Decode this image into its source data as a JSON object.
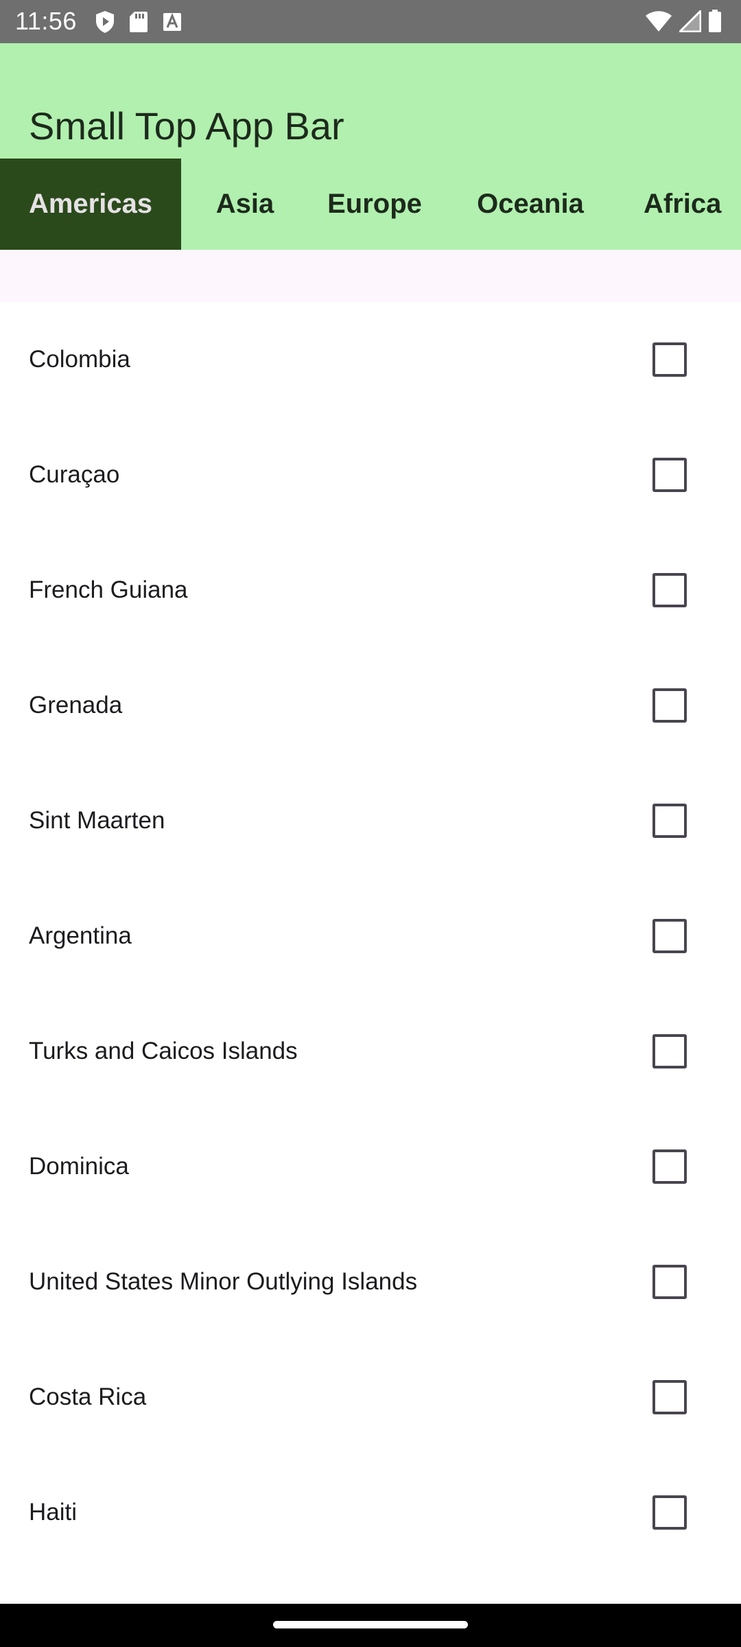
{
  "status_bar": {
    "time": "11:56",
    "left_icons": [
      "shield-play-icon",
      "sd-card-icon",
      "font-a-icon"
    ],
    "right_icons": [
      "wifi-icon",
      "cellular-signal-icon",
      "battery-icon"
    ],
    "background": "#6f6f6f"
  },
  "app_bar": {
    "title": "Small Top App Bar",
    "background": "#b1f0ae"
  },
  "tabs": [
    {
      "label": "Americas",
      "selected": true
    },
    {
      "label": "Asia",
      "selected": false
    },
    {
      "label": "Europe",
      "selected": false
    },
    {
      "label": "Oceania",
      "selected": false
    },
    {
      "label": "Africa",
      "selected": false
    }
  ],
  "colors": {
    "selected_tab": "#2a4a1b",
    "tab_bar": "#b1f0ae",
    "checkbox_border": "#49454f"
  },
  "countries": [
    {
      "name": "Colombia",
      "checked": false
    },
    {
      "name": "Curaçao",
      "checked": false
    },
    {
      "name": "French Guiana",
      "checked": false
    },
    {
      "name": "Grenada",
      "checked": false
    },
    {
      "name": "Sint Maarten",
      "checked": false
    },
    {
      "name": "Argentina",
      "checked": false
    },
    {
      "name": "Turks and Caicos Islands",
      "checked": false
    },
    {
      "name": "Dominica",
      "checked": false
    },
    {
      "name": "United States Minor Outlying Islands",
      "checked": false
    },
    {
      "name": "Costa Rica",
      "checked": false
    },
    {
      "name": "Haiti",
      "checked": false
    }
  ]
}
